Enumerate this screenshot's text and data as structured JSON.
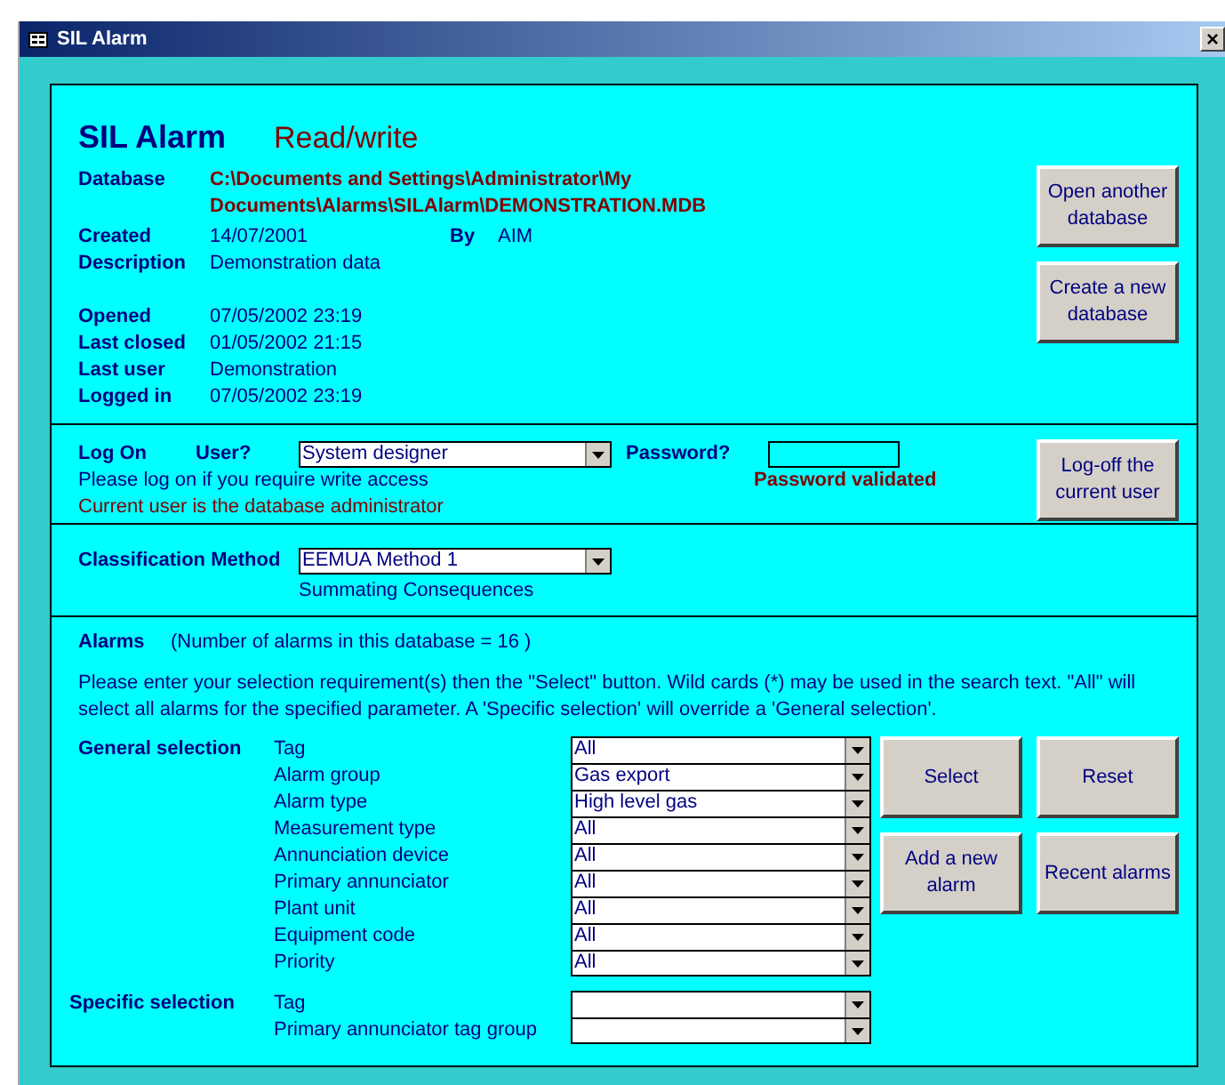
{
  "window": {
    "title": "SIL Alarm",
    "close": "×"
  },
  "header": {
    "app_name": "SIL Alarm",
    "mode": "Read/write"
  },
  "database": {
    "label": "Database",
    "value": "C:\\Documents and Settings\\Administrator\\My Documents\\Alarms\\SILAlarm\\DEMONSTRATION.MDB"
  },
  "created": {
    "label": "Created",
    "value": "14/07/2001",
    "by_label": "By",
    "by_value": "AIM"
  },
  "description": {
    "label": "Description",
    "value": "Demonstration data"
  },
  "session": [
    {
      "label": "Opened",
      "value": "07/05/2002 23:19"
    },
    {
      "label": "Last closed",
      "value": "01/05/2002 21:15"
    },
    {
      "label": "Last user",
      "value": "Demonstration"
    },
    {
      "label": "Logged in",
      "value": "07/05/2002 23:19"
    }
  ],
  "database_buttons": [
    "Open another database",
    "Create a new database"
  ],
  "log_on": {
    "heading": "Log On",
    "user_label": "User?",
    "user": "System designer",
    "password_label": "Password?",
    "password_status": "Password validated",
    "hint": "Please log on if you require write access",
    "current_user_note": "Current user is the database administrator",
    "button": "Log-off the current user"
  },
  "classification": {
    "label": "Classification Method",
    "value": "EEMUA Method 1",
    "note": "Summating Consequences"
  },
  "alarms": {
    "heading": "Alarms",
    "count_note": "(Number of alarms in this database = 16 )",
    "instructions": "Please enter your selection requirement(s) then the \"Select\" button. Wild cards (*) may be used in the search text.  \"All\" will select all alarms for the specified parameter. A 'Specific selection' will override a 'General selection'.",
    "general_selection": {
      "label": "General selection",
      "fields": [
        {
          "label": "Tag",
          "value": "All"
        },
        {
          "label": "Alarm group",
          "value": "Gas export"
        },
        {
          "label": "Alarm type",
          "value": "High level gas"
        },
        {
          "label": "Measurement type",
          "value": "All"
        },
        {
          "label": "Annunciation device",
          "value": "All"
        },
        {
          "label": "Primary annunciator",
          "value": "All"
        },
        {
          "label": "Plant unit",
          "value": "All"
        },
        {
          "label": "Equipment code",
          "value": "All"
        },
        {
          "label": "Priority",
          "value": "All"
        }
      ]
    },
    "specific_selection": {
      "label": "Specific selection",
      "fields": [
        {
          "label": "Tag"
        },
        {
          "label": "Primary annunciator tag group"
        }
      ]
    },
    "buttons": [
      "Select",
      "Reset",
      "Add a new alarm",
      "Recent alarms"
    ]
  }
}
